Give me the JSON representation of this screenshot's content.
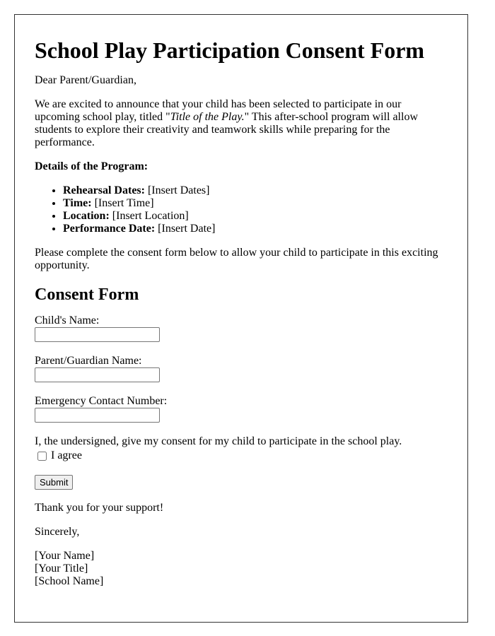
{
  "letter": {
    "title": "School Play Participation Consent Form",
    "salutation": "Dear Parent/Guardian,",
    "intro": {
      "before": "We are excited to announce that your child has been selected to participate in our upcoming school play, titled \"",
      "play_title": "Title of the Play.",
      "after": "\" This after-school program will allow students to explore their creativity and teamwork skills while preparing for the performance."
    },
    "details_heading": "Details of the Program:",
    "details": [
      {
        "label": "Rehearsal Dates:",
        "value": " [Insert Dates]"
      },
      {
        "label": "Time:",
        "value": " [Insert Time]"
      },
      {
        "label": "Location:",
        "value": " [Insert Location]"
      },
      {
        "label": "Performance Date:",
        "value": " [Insert Date]"
      }
    ],
    "instruction": "Please complete the consent form below to allow your child to participate in this exciting opportunity."
  },
  "form": {
    "heading": "Consent Form",
    "fields": [
      {
        "label": "Child's Name:",
        "value": "",
        "placeholder": ""
      },
      {
        "label": "Parent/Guardian Name:",
        "value": "",
        "placeholder": ""
      },
      {
        "label": "Emergency Contact Number:",
        "value": "",
        "placeholder": ""
      }
    ],
    "consent_statement": "I, the undersigned, give my consent for my child to participate in the school play.",
    "agree_label": "I agree",
    "agree_checked": false,
    "submit_label": "Submit"
  },
  "closing": {
    "thanks": "Thank you for your support!",
    "signoff": "Sincerely,",
    "signature_lines": [
      "[Your Name]",
      "[Your Title]",
      "[School Name]"
    ]
  }
}
